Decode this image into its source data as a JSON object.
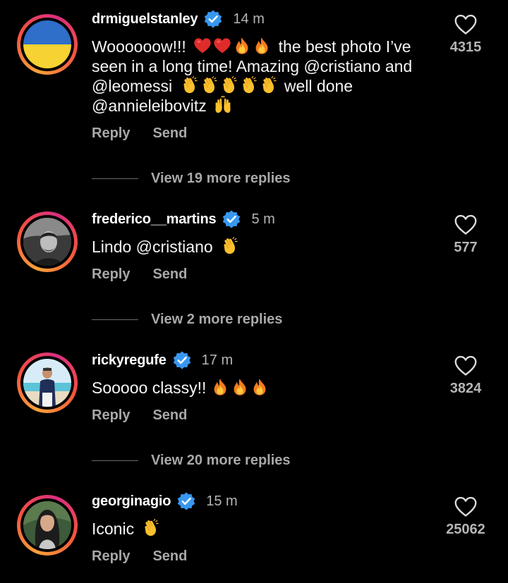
{
  "actions": {
    "reply_label": "Reply",
    "send_label": "Send"
  },
  "colors": {
    "background": "#000000",
    "verified_badge": "#3897f0",
    "story_ring": "#d92e7f"
  },
  "icons": {
    "like": "heart-outline-icon",
    "verified": "verified-badge-icon"
  },
  "comments": [
    {
      "username": "drmiguelstanley",
      "verified": true,
      "time": "14 m",
      "text_1": "Woooooow!!!",
      "text_2": "the best photo I’ve seen in a long time! Amazing @cristiano and @leomessi",
      "text_3": "well done @annieleibovitz",
      "likes": "4315",
      "view_replies": "View 19 more replies",
      "avatar": "ukraine-flag"
    },
    {
      "username": "frederico__martins",
      "verified": true,
      "time": "5 m",
      "text_1": "Lindo @cristiano",
      "likes": "577",
      "view_replies": "View 2 more replies",
      "avatar": "man-portrait-bw"
    },
    {
      "username": "rickyregufe",
      "verified": true,
      "time": "17 m",
      "text_1": "Sooooo classy!!",
      "likes": "3824",
      "view_replies": "View 20 more replies",
      "avatar": "man-beach-photo"
    },
    {
      "username": "georginagio",
      "verified": true,
      "time": "15 m",
      "text_1": "Iconic",
      "likes": "25062",
      "avatar": "woman-portrait"
    }
  ]
}
